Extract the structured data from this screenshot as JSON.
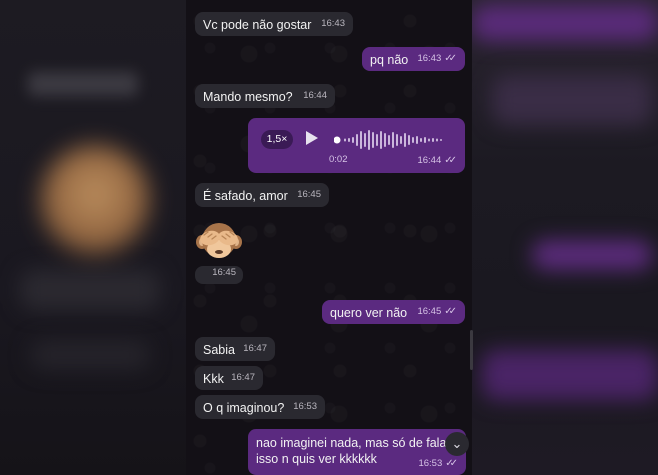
{
  "messages": [
    {
      "text": "Vc pode não gostar",
      "time": "16:43",
      "dir": "in"
    },
    {
      "text": "pq não",
      "time": "16:43",
      "dir": "out"
    },
    {
      "text": "Mando mesmo?",
      "time": "16:44",
      "dir": "in"
    },
    {
      "type": "voice",
      "speed": "1,5×",
      "duration": "0:02",
      "time": "16:44",
      "dir": "out",
      "progress": 0
    },
    {
      "text": "É safado, amor",
      "time": "16:45",
      "dir": "in"
    },
    {
      "type": "emoji",
      "emoji_icon": "see-no-evil-monkey-icon",
      "time": "16:45",
      "dir": "in"
    },
    {
      "text": "quero ver não",
      "time": "16:45",
      "dir": "out"
    },
    {
      "text": "Sabia",
      "time": "16:47",
      "dir": "in"
    },
    {
      "text": "Kkk",
      "time": "16:47",
      "dir": "in"
    },
    {
      "text": "O q imaginou?",
      "time": "16:53",
      "dir": "in"
    },
    {
      "text_line1": "nao imaginei nada, mas só de fala",
      "text_line2": "isso n quis ver kkkkkk",
      "time": "16:53",
      "dir": "out"
    }
  ],
  "icons": {
    "read_receipt": "double-check-icon",
    "play": "play-icon",
    "scroll_down": "chevron-down-icon"
  },
  "colors": {
    "incoming_bubble": "#2a2930",
    "outgoing_bubble": "#5b2a80",
    "background": "#131016"
  }
}
